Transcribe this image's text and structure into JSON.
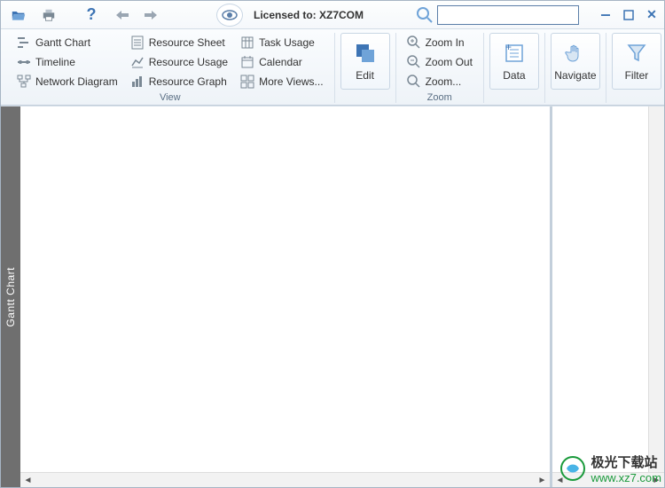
{
  "titlebar": {
    "license_label": "Licensed to: XZ7COM"
  },
  "ribbon": {
    "view": {
      "label": "View",
      "gantt": "Gantt Chart",
      "timeline": "Timeline",
      "network": "Network Diagram",
      "resource_sheet": "Resource Sheet",
      "resource_usage": "Resource Usage",
      "resource_graph": "Resource Graph",
      "task_usage": "Task Usage",
      "calendar": "Calendar",
      "more_views": "More Views..."
    },
    "edit": {
      "label": "Edit"
    },
    "zoom": {
      "label": "Zoom",
      "in": "Zoom In",
      "out": "Zoom Out",
      "zoom": "Zoom..."
    },
    "data": {
      "label": "Data"
    },
    "navigate": {
      "label": "Navigate"
    },
    "filter": {
      "label": "Filter"
    }
  },
  "side_tab": "Gantt Chart",
  "watermark": {
    "zh": "极光下载站",
    "url": "www.xz7.com"
  },
  "colors": {
    "icon_blue": "#3d74b4",
    "icon_gray": "#7a8894"
  }
}
